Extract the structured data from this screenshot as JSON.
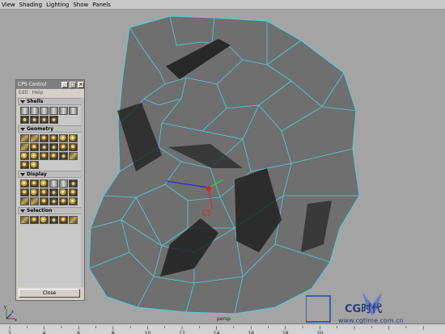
{
  "menu": [
    "View",
    "Shading",
    "Lighting",
    "Show",
    "Panels"
  ],
  "cps_panel": {
    "title": "CPS Control",
    "menu": [
      "Edit",
      "Help"
    ],
    "sections": [
      {
        "label": "Shells"
      },
      {
        "label": "Geometry"
      },
      {
        "label": "Display"
      },
      {
        "label": "Selection"
      }
    ],
    "close_label": "Close"
  },
  "viewport": {
    "camera_label": "persp",
    "axis_labels": [
      "y",
      "z",
      "x"
    ]
  },
  "timeline": {
    "ticks": [
      "2",
      "4",
      "6",
      "8",
      "10",
      "12",
      "14",
      "16",
      "18",
      "20"
    ]
  },
  "watermark": {
    "brand": "CG时代",
    "url": "www.cgtime.com.cn"
  },
  "colors": {
    "wire": "#4fd0e4",
    "mesh": "#6e6e6e",
    "background": "#a4a4a4"
  }
}
